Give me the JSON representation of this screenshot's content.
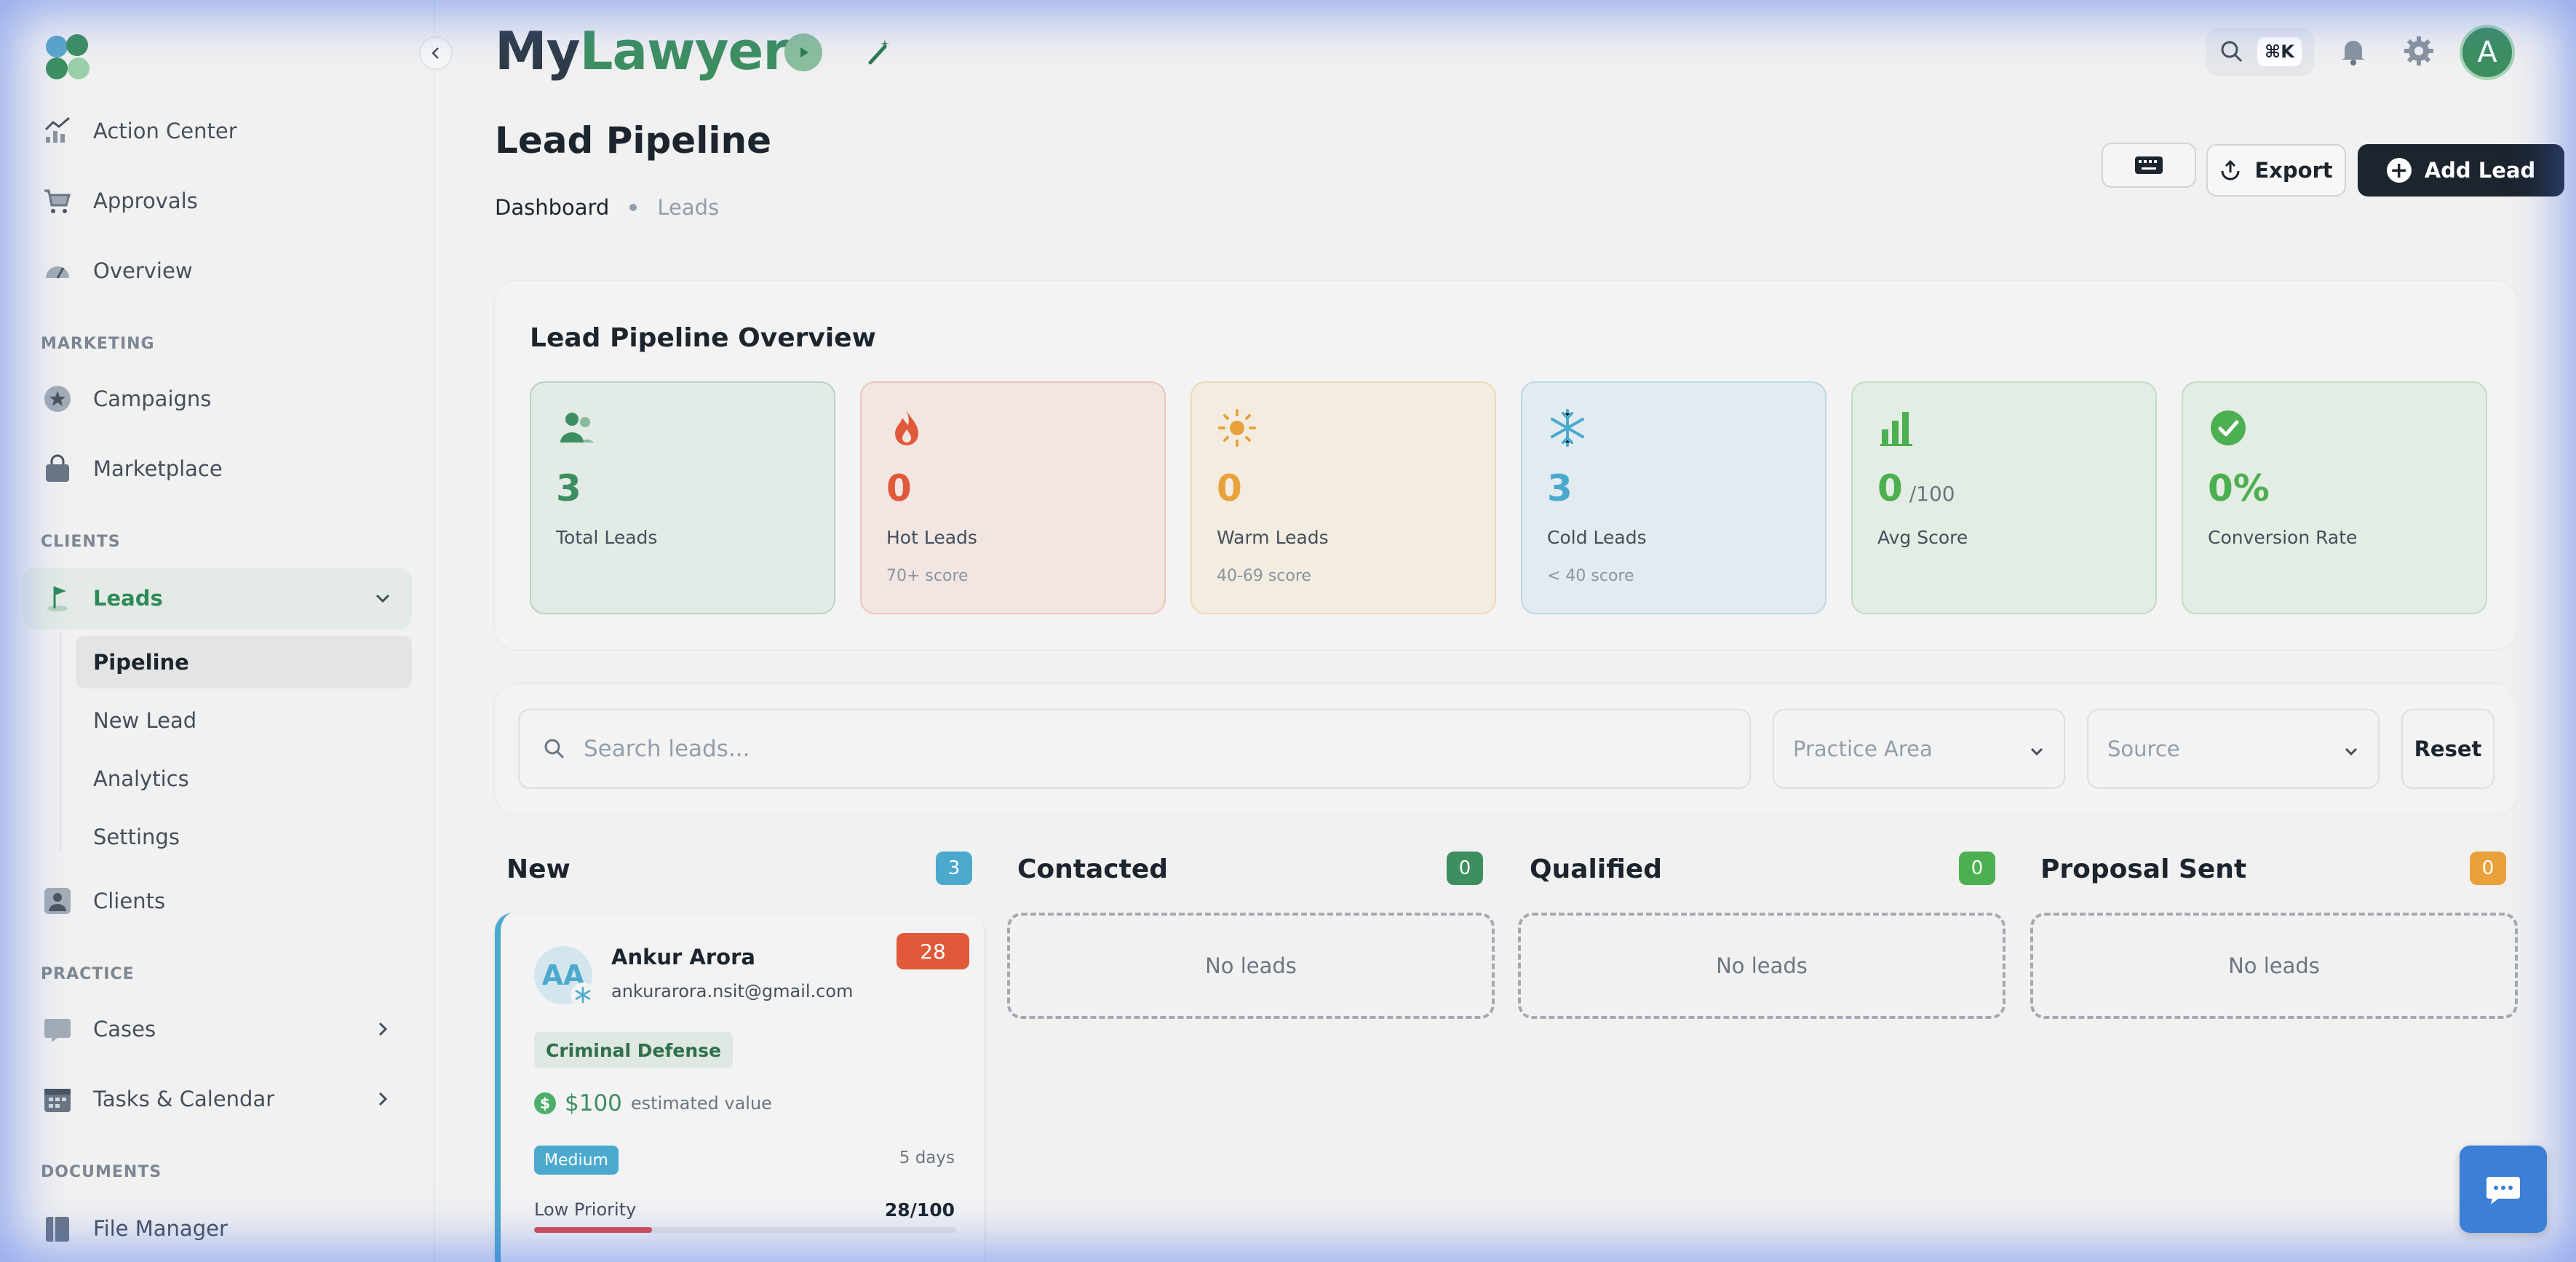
{
  "app": {
    "brand_my": "My",
    "brand_lawyer": "Lawyer",
    "search_shortcut": "⌘K",
    "avatar_initial": "A",
    "accent": "#3d8f5f"
  },
  "sidebar": {
    "items_top": [
      {
        "label": "Action Center",
        "icon": "chart-icon"
      },
      {
        "label": "Approvals",
        "icon": "cart-icon"
      },
      {
        "label": "Overview",
        "icon": "gauge-icon"
      }
    ],
    "marketing_label": "MARKETING",
    "marketing": [
      {
        "label": "Campaigns",
        "icon": "star-icon"
      },
      {
        "label": "Marketplace",
        "icon": "bag-icon"
      }
    ],
    "clients_label": "CLIENTS",
    "leads": {
      "label": "Leads",
      "icon": "flag-icon"
    },
    "leads_sub": [
      {
        "label": "Pipeline"
      },
      {
        "label": "New Lead"
      },
      {
        "label": "Analytics"
      },
      {
        "label": "Settings"
      }
    ],
    "clients": {
      "label": "Clients",
      "icon": "contact-icon"
    },
    "practice_label": "PRACTICE",
    "practice": [
      {
        "label": "Cases",
        "icon": "folder-icon"
      },
      {
        "label": "Tasks & Calendar",
        "icon": "calendar-icon"
      }
    ],
    "documents_label": "DOCUMENTS",
    "documents": [
      {
        "label": "File Manager",
        "icon": "file-icon"
      }
    ]
  },
  "page": {
    "title": "Lead Pipeline",
    "breadcrumb": [
      "Dashboard",
      "Leads"
    ],
    "export_label": "Export",
    "add_label": "Add Lead"
  },
  "overview": {
    "title": "Lead Pipeline Overview",
    "stats": [
      {
        "value": "3",
        "suffix": "",
        "label": "Total Leads",
        "sub": "",
        "color": "#3d8f5f",
        "bg": "#e2ebe5",
        "border": "#b9d3c1",
        "icon": "users-icon"
      },
      {
        "value": "0",
        "suffix": "",
        "label": "Hot Leads",
        "sub": "70+ score",
        "color": "#e05a3a",
        "bg": "#f2e6e3",
        "border": "#ebc5bc",
        "icon": "fire-icon"
      },
      {
        "value": "0",
        "suffix": "",
        "label": "Warm Leads",
        "sub": "40-69 score",
        "color": "#e9a23b",
        "bg": "#f3ece0",
        "border": "#eed9b4",
        "icon": "sun-icon"
      },
      {
        "value": "3",
        "suffix": "",
        "label": "Cold Leads",
        "sub": "< 40 score",
        "color": "#4ba9ce",
        "bg": "#e2ebef",
        "border": "#bcd8e4",
        "icon": "snowflake-icon"
      },
      {
        "value": "0",
        "suffix": "/100",
        "label": "Avg Score",
        "sub": "",
        "color": "#4caf50",
        "bg": "#e4ede4",
        "border": "#c3dcc4",
        "icon": "bars-icon"
      },
      {
        "value": "0%",
        "suffix": "",
        "label": "Conversion Rate",
        "sub": "",
        "color": "#4caf50",
        "bg": "#e4ede4",
        "border": "#c3dcc4",
        "icon": "check-icon"
      }
    ]
  },
  "filters": {
    "search_placeholder": "Search leads...",
    "practice_area": "Practice Area",
    "source": "Source",
    "reset": "Reset"
  },
  "columns": [
    {
      "title": "New",
      "count": "3",
      "color": "#4ba9ce"
    },
    {
      "title": "Contacted",
      "count": "0",
      "color": "#3d8f5f"
    },
    {
      "title": "Qualified",
      "count": "0",
      "color": "#4caf50"
    },
    {
      "title": "Proposal Sent",
      "count": "0",
      "color": "#e9a23b"
    }
  ],
  "empty_label": "No leads",
  "lead": {
    "initials": "AA",
    "name": "Ankur Arora",
    "email": "ankurarora.nsit@gmail.com",
    "score": "28",
    "practice_area": "Criminal Defense",
    "value": "$100",
    "value_label": "estimated value",
    "priority_badge": "Medium",
    "age": "5 days",
    "priority_label": "Low Priority",
    "priority_score": "28/100",
    "priority_fraction": 0.28
  }
}
